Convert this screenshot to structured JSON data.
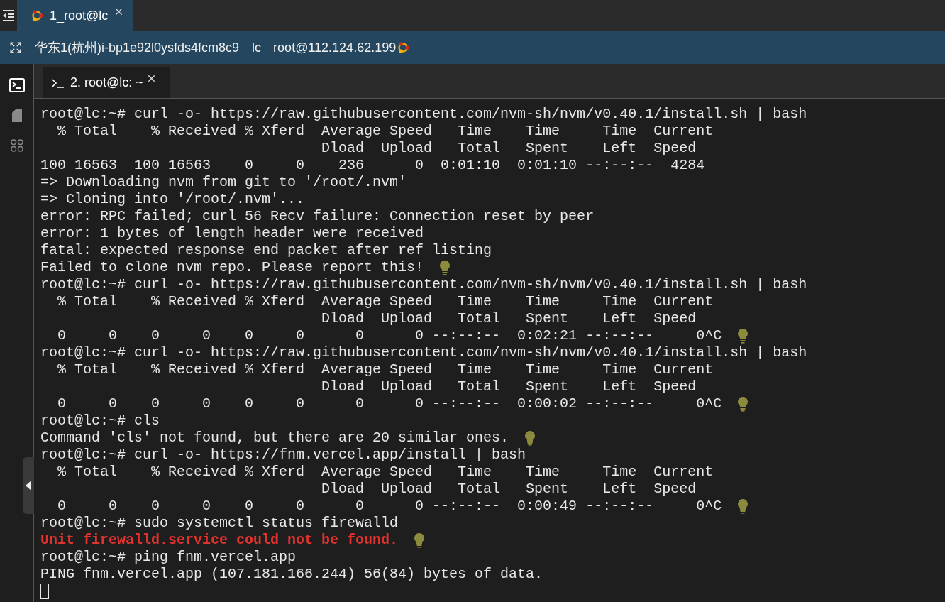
{
  "app_tabs": [
    {
      "label": "1_root@lc",
      "selected": true
    }
  ],
  "connection": {
    "region": "华东1(杭州)i-bp1e92l0ysfds4fcm8c9",
    "host": "lc",
    "address": "root@112.124.62.199"
  },
  "session_tabs": [
    {
      "label": "2. root@lc: ~",
      "selected": true
    }
  ],
  "terminal": {
    "cursor": true,
    "lines": [
      {
        "text": "root@lc:~# curl -o- https://raw.githubusercontent.com/nvm-sh/nvm/v0.40.1/install.sh | bash",
        "kind": "normal",
        "hint": false
      },
      {
        "text": "  % Total    % Received % Xferd  Average Speed   Time    Time     Time  Current",
        "kind": "normal",
        "hint": false
      },
      {
        "text": "                                 Dload  Upload   Total   Spent    Left  Speed",
        "kind": "normal",
        "hint": false
      },
      {
        "text": "100 16563  100 16563    0     0    236      0  0:01:10  0:01:10 --:--:--  4284",
        "kind": "normal",
        "hint": false
      },
      {
        "text": "=> Downloading nvm from git to '/root/.nvm'",
        "kind": "normal",
        "hint": false
      },
      {
        "text": "=> Cloning into '/root/.nvm'...",
        "kind": "normal",
        "hint": false
      },
      {
        "text": "error: RPC failed; curl 56 Recv failure: Connection reset by peer",
        "kind": "normal",
        "hint": false
      },
      {
        "text": "error: 1 bytes of length header were received",
        "kind": "normal",
        "hint": false
      },
      {
        "text": "fatal: expected response end packet after ref listing",
        "kind": "normal",
        "hint": false
      },
      {
        "text": "Failed to clone nvm repo. Please report this!",
        "kind": "normal",
        "hint": true
      },
      {
        "text": "root@lc:~# curl -o- https://raw.githubusercontent.com/nvm-sh/nvm/v0.40.1/install.sh | bash",
        "kind": "normal",
        "hint": false
      },
      {
        "text": "  % Total    % Received % Xferd  Average Speed   Time    Time     Time  Current",
        "kind": "normal",
        "hint": false
      },
      {
        "text": "                                 Dload  Upload   Total   Spent    Left  Speed",
        "kind": "normal",
        "hint": false
      },
      {
        "text": "  0     0    0     0    0     0      0      0 --:--:--  0:02:21 --:--:--     0^C",
        "kind": "normal",
        "hint": true
      },
      {
        "text": "root@lc:~# curl -o- https://raw.githubusercontent.com/nvm-sh/nvm/v0.40.1/install.sh | bash",
        "kind": "normal",
        "hint": false
      },
      {
        "text": "  % Total    % Received % Xferd  Average Speed   Time    Time     Time  Current",
        "kind": "normal",
        "hint": false
      },
      {
        "text": "                                 Dload  Upload   Total   Spent    Left  Speed",
        "kind": "normal",
        "hint": false
      },
      {
        "text": "  0     0    0     0    0     0      0      0 --:--:--  0:00:02 --:--:--     0^C",
        "kind": "normal",
        "hint": true
      },
      {
        "text": "root@lc:~# cls",
        "kind": "normal",
        "hint": false
      },
      {
        "text": "Command 'cls' not found, but there are 20 similar ones.",
        "kind": "normal",
        "hint": true
      },
      {
        "text": "root@lc:~# curl -o- https://fnm.vercel.app/install | bash",
        "kind": "normal",
        "hint": false
      },
      {
        "text": "  % Total    % Received % Xferd  Average Speed   Time    Time     Time  Current",
        "kind": "normal",
        "hint": false
      },
      {
        "text": "                                 Dload  Upload   Total   Spent    Left  Speed",
        "kind": "normal",
        "hint": false
      },
      {
        "text": "  0     0    0     0    0     0      0      0 --:--:--  0:00:49 --:--:--     0^C",
        "kind": "normal",
        "hint": true
      },
      {
        "text": "root@lc:~# sudo systemctl status firewalld",
        "kind": "normal",
        "hint": false
      },
      {
        "text": "Unit firewalld.service could not be found.",
        "kind": "error",
        "hint": true
      },
      {
        "text": "root@lc:~# ping fnm.vercel.app",
        "kind": "normal",
        "hint": false
      },
      {
        "text": "PING fnm.vercel.app (107.181.166.244) 56(84) bytes of data.",
        "kind": "normal",
        "hint": false
      }
    ]
  }
}
